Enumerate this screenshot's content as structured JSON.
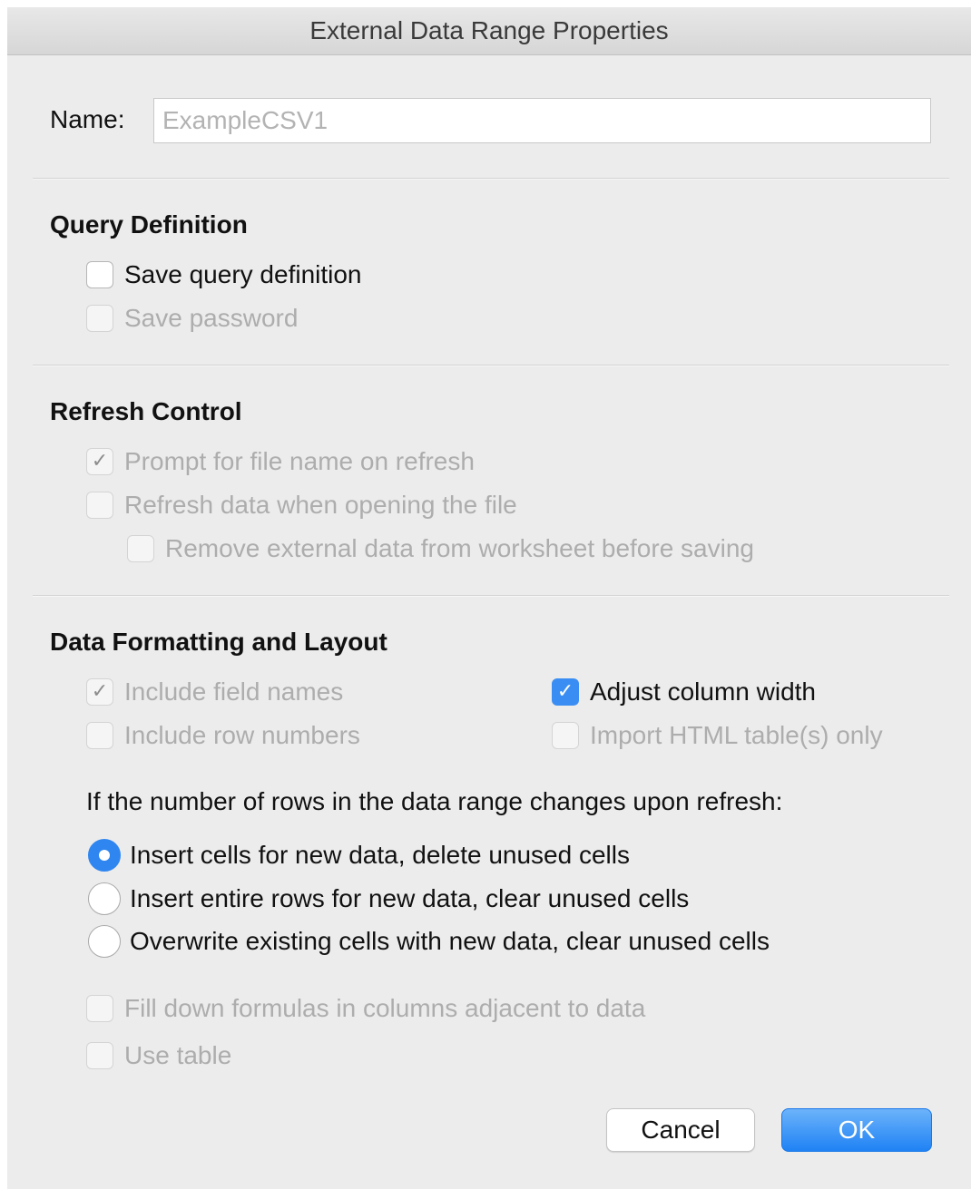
{
  "window": {
    "title": "External Data Range Properties"
  },
  "name": {
    "label": "Name:",
    "value": "ExampleCSV1"
  },
  "query_definition": {
    "heading": "Query Definition",
    "save_query_definition": {
      "label": "Save query definition",
      "checked": false,
      "enabled": true
    },
    "save_password": {
      "label": "Save password",
      "checked": false,
      "enabled": false
    }
  },
  "refresh_control": {
    "heading": "Refresh Control",
    "prompt_file_name": {
      "label": "Prompt for file name on refresh",
      "checked": true,
      "enabled": false
    },
    "refresh_on_open": {
      "label": "Refresh data when opening the file",
      "checked": false,
      "enabled": false
    },
    "remove_external_data": {
      "label": "Remove external data from worksheet before saving",
      "checked": false,
      "enabled": false
    }
  },
  "data_formatting": {
    "heading": "Data Formatting and Layout",
    "include_field_names": {
      "label": "Include field names",
      "checked": true,
      "enabled": false
    },
    "include_row_numbers": {
      "label": "Include row numbers",
      "checked": false,
      "enabled": false
    },
    "adjust_column_width": {
      "label": "Adjust column width",
      "checked": true,
      "enabled": true
    },
    "import_html_only": {
      "label": "Import HTML table(s) only",
      "checked": false,
      "enabled": false
    },
    "rows_change_prompt": "If the number of rows in the data range changes upon refresh:",
    "radio_options": [
      {
        "label": "Insert cells for new data, delete unused cells",
        "selected": true
      },
      {
        "label": "Insert entire rows for new data, clear unused cells",
        "selected": false
      },
      {
        "label": "Overwrite existing cells with new data, clear unused cells",
        "selected": false
      }
    ],
    "fill_down_formulas": {
      "label": "Fill down formulas in columns adjacent to data",
      "checked": false,
      "enabled": false
    },
    "use_table": {
      "label": "Use table",
      "checked": false,
      "enabled": false
    }
  },
  "buttons": {
    "cancel": "Cancel",
    "ok": "OK"
  },
  "colors": {
    "accent": "#2f86f0",
    "window_background": "#ececec",
    "disabled_text": "#adadad"
  },
  "icons": {
    "check": "checkmark-icon",
    "radio_dot": "radio-dot-icon"
  }
}
